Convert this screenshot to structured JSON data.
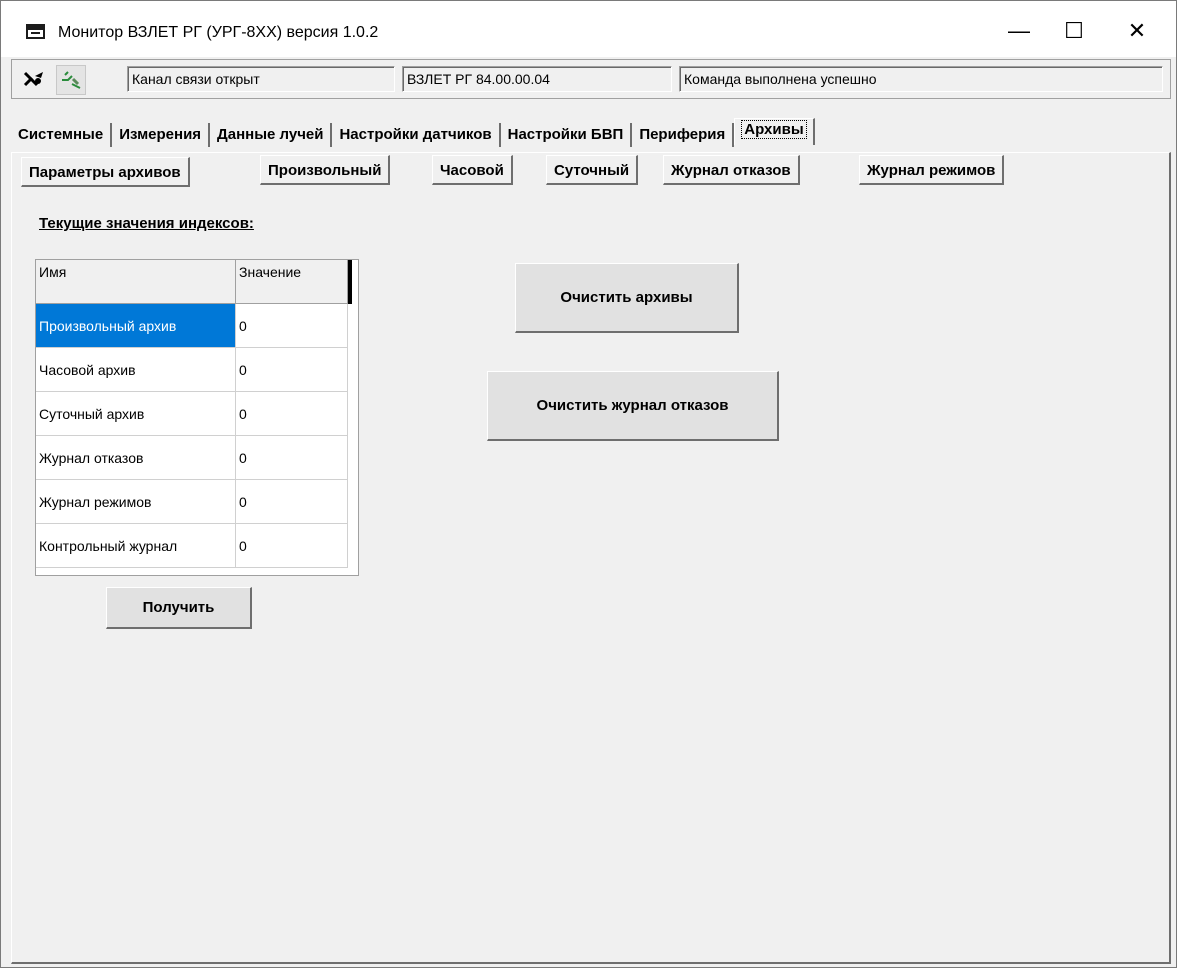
{
  "window": {
    "title": "Монитор ВЗЛЕТ РГ (УРГ-8XX) версия 1.0.2",
    "controls": {
      "minimize": "—",
      "maximize": "☐",
      "close": "✕"
    }
  },
  "toolbar": {
    "icons": [
      "disconnect-icon",
      "connect-icon"
    ],
    "channel_status": "Канал связи открыт",
    "device_version": "ВЗЛЕТ РГ 84.00.00.04",
    "command_status": "Команда выполнена успешно"
  },
  "main_tabs": [
    {
      "label": "Системные"
    },
    {
      "label": "Измерения"
    },
    {
      "label": "Данные лучей"
    },
    {
      "label": "Настройки датчиков"
    },
    {
      "label": "Настройки БВП"
    },
    {
      "label": "Периферия"
    },
    {
      "label": "Архивы",
      "active": true
    }
  ],
  "sub_tabs": [
    {
      "label": "Параметры архивов",
      "active": true
    },
    {
      "label": "Произвольный"
    },
    {
      "label": "Часовой"
    },
    {
      "label": "Суточный"
    },
    {
      "label": "Журнал отказов"
    },
    {
      "label": "Журнал режимов"
    }
  ],
  "indexes": {
    "title": "Текущие значения индексов:",
    "columns": [
      "Имя",
      "Значение"
    ],
    "rows": [
      {
        "name": "Произвольный архив",
        "value": "0",
        "selected": true
      },
      {
        "name": "Часовой архив",
        "value": "0"
      },
      {
        "name": "Суточный архив",
        "value": "0"
      },
      {
        "name": "Журнал отказов",
        "value": "0"
      },
      {
        "name": "Журнал режимов",
        "value": "0"
      },
      {
        "name": "Контрольный журнал",
        "value": "0"
      }
    ],
    "get_button": "Получить"
  },
  "actions": {
    "clear_archives": "Очистить архивы",
    "clear_fault_log": "Очистить журнал отказов"
  },
  "colors": {
    "selection": "#0078d7",
    "background": "#f0f0f0"
  }
}
